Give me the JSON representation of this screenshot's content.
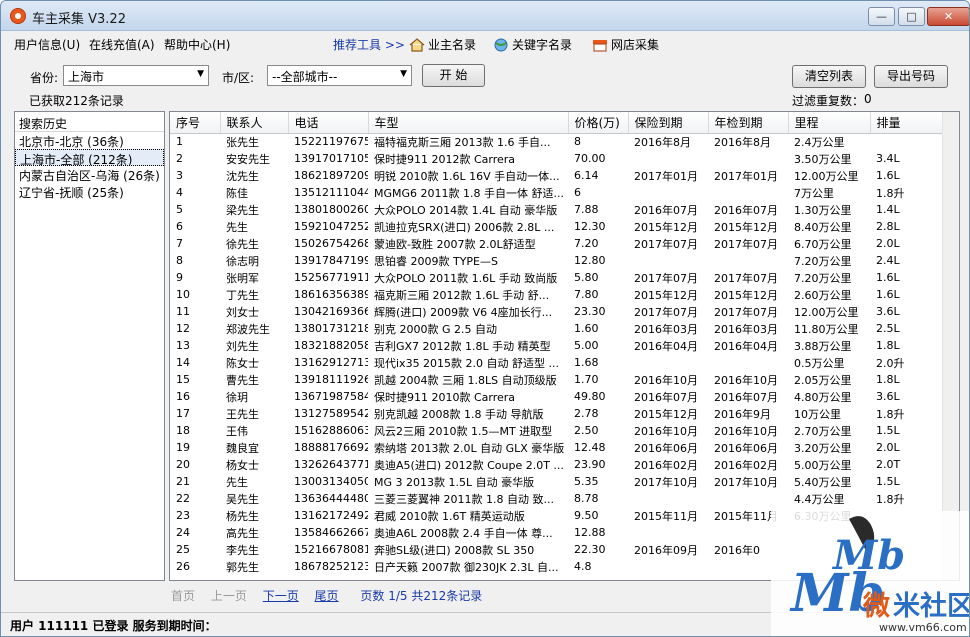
{
  "window": {
    "title": "车主采集 V3.22",
    "min": "—",
    "max": "□",
    "close": "✕"
  },
  "menu": {
    "items": [
      "用户信息(U)",
      "在线充值(A)",
      "帮助中心(H)"
    ],
    "recommend": "推荐工具 >>",
    "tools": [
      "业主名录",
      "关键字名录",
      "网店采集"
    ]
  },
  "filters": {
    "province_label": "省份:",
    "province_value": "上海市",
    "city_label": "市/区:",
    "city_value": "--全部城市--",
    "start": "开 始",
    "clear": "清空列表",
    "export": "导出号码",
    "fetched": "已获取212条记录",
    "dedupe": "过滤重复数：",
    "dedupe_count": "0"
  },
  "history": {
    "title": "搜索历史",
    "items": [
      "北京市-北京 (36条)",
      "上海市-全部 (212条)",
      "内蒙古自治区-乌海 (26条)",
      "辽宁省-抚顺 (25条)"
    ]
  },
  "table": {
    "columns": [
      "序号",
      "联系人",
      "电话",
      "车型",
      "价格(万)",
      "保险到期",
      "年检到期",
      "里程",
      "排量"
    ],
    "rows": [
      [
        "1",
        "张先生",
        "15221197675",
        "福特福克斯三厢 2013款 1.6 手自...",
        "8",
        "2016年8月",
        "2016年8月",
        "2.4万公里",
        ""
      ],
      [
        "2",
        "安安先生",
        "13917017105",
        "保时捷911 2012款 Carrera",
        "70.00",
        "",
        "",
        "3.50万公里",
        "3.4L"
      ],
      [
        "3",
        "沈先生",
        "18621897209",
        "明锐 2010款 1.6L 16V 手自动一体...",
        "6.14",
        "2017年01月",
        "2017年01月",
        "12.00万公里",
        "1.6L"
      ],
      [
        "4",
        "陈佳",
        "13512111044",
        "MGMG6 2011款 1.8 手自一体 舒适...",
        "6",
        "",
        "",
        "7万公里",
        "1.8升"
      ],
      [
        "5",
        "梁先生",
        "13801800260",
        "大众POLO 2014款 1.4L 自动 豪华版",
        "7.88",
        "2016年07月",
        "2016年07月",
        "1.30万公里",
        "1.4L"
      ],
      [
        "6",
        "先生",
        "15921047252",
        "凯迪拉克SRX(进口) 2006款 2.8L ...",
        "12.30",
        "2015年12月",
        "2015年12月",
        "8.40万公里",
        "2.8L"
      ],
      [
        "7",
        "徐先生",
        "15026754268",
        "蒙迪欧-致胜 2007款 2.0L舒适型",
        "7.20",
        "2017年07月",
        "2017年07月",
        "6.70万公里",
        "2.0L"
      ],
      [
        "8",
        "徐志明",
        "13917847199",
        "思铂睿 2009款 TYPE—S",
        "12.80",
        "",
        "",
        "7.20万公里",
        "2.4L"
      ],
      [
        "9",
        "张明军",
        "15256771911",
        "大众POLO 2011款 1.6L 手动 致尚版",
        "5.80",
        "2017年07月",
        "2017年07月",
        "7.20万公里",
        "1.6L"
      ],
      [
        "10",
        "丁先生",
        "18616356389",
        "福克斯三厢 2012款 1.6L 手动 舒...",
        "7.80",
        "2015年12月",
        "2015年12月",
        "2.60万公里",
        "1.6L"
      ],
      [
        "11",
        "刘女士",
        "13042169366",
        "辉腾(进口) 2009款 V6 4座加长行...",
        "23.30",
        "2017年07月",
        "2017年07月",
        "12.00万公里",
        "3.6L"
      ],
      [
        "12",
        "郑波先生",
        "13801731218",
        "别克 2000款 G 2.5 自动",
        "1.60",
        "2016年03月",
        "2016年03月",
        "11.80万公里",
        "2.5L"
      ],
      [
        "13",
        "刘先生",
        "18321882058",
        "吉利GX7 2012款 1.8L 手动 精英型",
        "5.00",
        "2016年04月",
        "2016年04月",
        "3.88万公里",
        "1.8L"
      ],
      [
        "14",
        "陈女士",
        "13162912713",
        "现代ix35 2015款 2.0 自动 舒适型 ...",
        "1.68",
        "",
        "",
        "0.5万公里",
        "2.0升"
      ],
      [
        "15",
        "曹先生",
        "13918111926",
        "凯越 2004款 三厢 1.8LS 自动顶级版",
        "1.70",
        "2016年10月",
        "2016年10月",
        "2.05万公里",
        "1.8L"
      ],
      [
        "16",
        "徐玥",
        "13671987584",
        "保时捷911 2010款 Carrera",
        "49.80",
        "2016年07月",
        "2016年07月",
        "4.80万公里",
        "3.6L"
      ],
      [
        "17",
        "王先生",
        "13127589542",
        "别克凯越 2008款 1.8 手动 导航版",
        "2.78",
        "2015年12月",
        "2016年9月",
        "10万公里",
        "1.8升"
      ],
      [
        "18",
        "王伟",
        "15162886063",
        "风云2三厢 2010款 1.5—MT 进取型",
        "2.50",
        "2016年10月",
        "2016年10月",
        "2.70万公里",
        "1.5L"
      ],
      [
        "19",
        "魏良宜",
        "18888176692",
        "索纳塔 2013款 2.0L 自动 GLX 豪华版",
        "12.48",
        "2016年06月",
        "2016年06月",
        "3.20万公里",
        "2.0L"
      ],
      [
        "20",
        "杨女士",
        "13262643771",
        "奥迪A5(进口) 2012款 Coupe 2.0T ...",
        "23.90",
        "2016年02月",
        "2016年02月",
        "5.00万公里",
        "2.0T"
      ],
      [
        "21",
        "先生",
        "13003134050",
        "MG 3 2013款 1.5L 自动 豪华版",
        "5.35",
        "2017年10月",
        "2017年10月",
        "5.40万公里",
        "1.5L"
      ],
      [
        "22",
        "吴先生",
        "13636444480",
        "三菱三菱翼神 2011款 1.8 自动 致...",
        "8.78",
        "",
        "",
        "4.4万公里",
        "1.8升"
      ],
      [
        "23",
        "杨先生",
        "13162172492",
        "君威 2010款 1.6T 精英运动版",
        "9.50",
        "2015年11月",
        "2015年11月",
        "6.30万公里",
        ""
      ],
      [
        "24",
        "高先生",
        "13584662667",
        "奥迪A6L 2008款 2.4 手自一体 尊...",
        "12.88",
        "",
        "",
        "",
        ""
      ],
      [
        "25",
        "李先生",
        "15216678081",
        "奔驰SL级(进口) 2008款 SL 350",
        "22.30",
        "2016年09月",
        "2016年0",
        "",
        ""
      ],
      [
        "26",
        "郭先生",
        "18678252123",
        "日产天籁 2007款 御230JK 2.3L 自...",
        "4.8",
        "",
        "",
        "",
        ""
      ]
    ]
  },
  "pager": {
    "first": "首页",
    "prev": "上一页",
    "next": "下一页",
    "last": "尾页",
    "info": "页数 1/5 共212条记录"
  },
  "status": {
    "text": "用户 111111 已登录  服务到期时间："
  },
  "watermark": {
    "text": "微米社区",
    "url": "www.vm66.com"
  }
}
